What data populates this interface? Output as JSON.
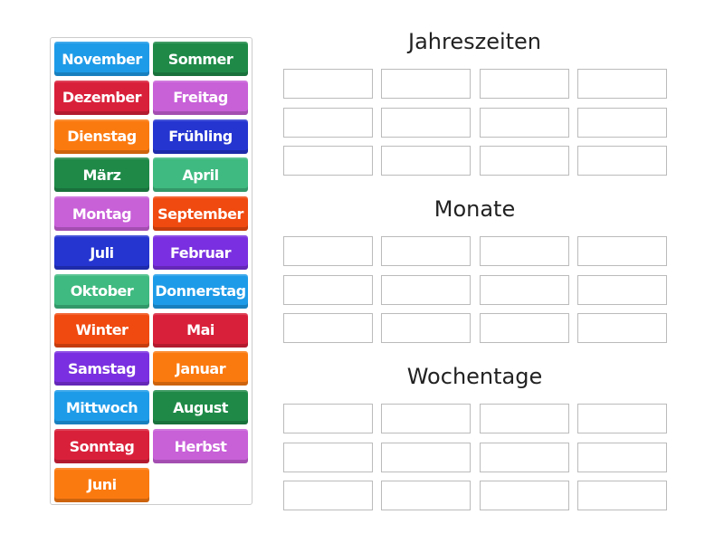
{
  "tiles": [
    {
      "label": "November",
      "color": "#1e9be8"
    },
    {
      "label": "Sommer",
      "color": "#1f8a48"
    },
    {
      "label": "Dezember",
      "color": "#d9203a"
    },
    {
      "label": "Freitag",
      "color": "#c860d8"
    },
    {
      "label": "Dienstag",
      "color": "#fb7a10"
    },
    {
      "label": "Frühling",
      "color": "#2535d0"
    },
    {
      "label": "März",
      "color": "#1f8a48"
    },
    {
      "label": "April",
      "color": "#3fba80"
    },
    {
      "label": "Montag",
      "color": "#c860d8"
    },
    {
      "label": "September",
      "color": "#f04a10"
    },
    {
      "label": "Juli",
      "color": "#2535d0"
    },
    {
      "label": "Februar",
      "color": "#7a30e0"
    },
    {
      "label": "Oktober",
      "color": "#3fba80"
    },
    {
      "label": "Donnerstag",
      "color": "#1e9be8"
    },
    {
      "label": "Winter",
      "color": "#f04a10"
    },
    {
      "label": "Mai",
      "color": "#d9203a"
    },
    {
      "label": "Samstag",
      "color": "#7a30e0"
    },
    {
      "label": "Januar",
      "color": "#fb7a10"
    },
    {
      "label": "Mittwoch",
      "color": "#1e9be8"
    },
    {
      "label": "August",
      "color": "#1f8a48"
    },
    {
      "label": "Sonntag",
      "color": "#d9203a"
    },
    {
      "label": "Herbst",
      "color": "#c860d8"
    },
    {
      "label": "Juni",
      "color": "#fb7a10"
    }
  ],
  "groups": [
    {
      "title": "Jahreszeiten"
    },
    {
      "title": "Monate"
    },
    {
      "title": "Wochentage"
    }
  ]
}
